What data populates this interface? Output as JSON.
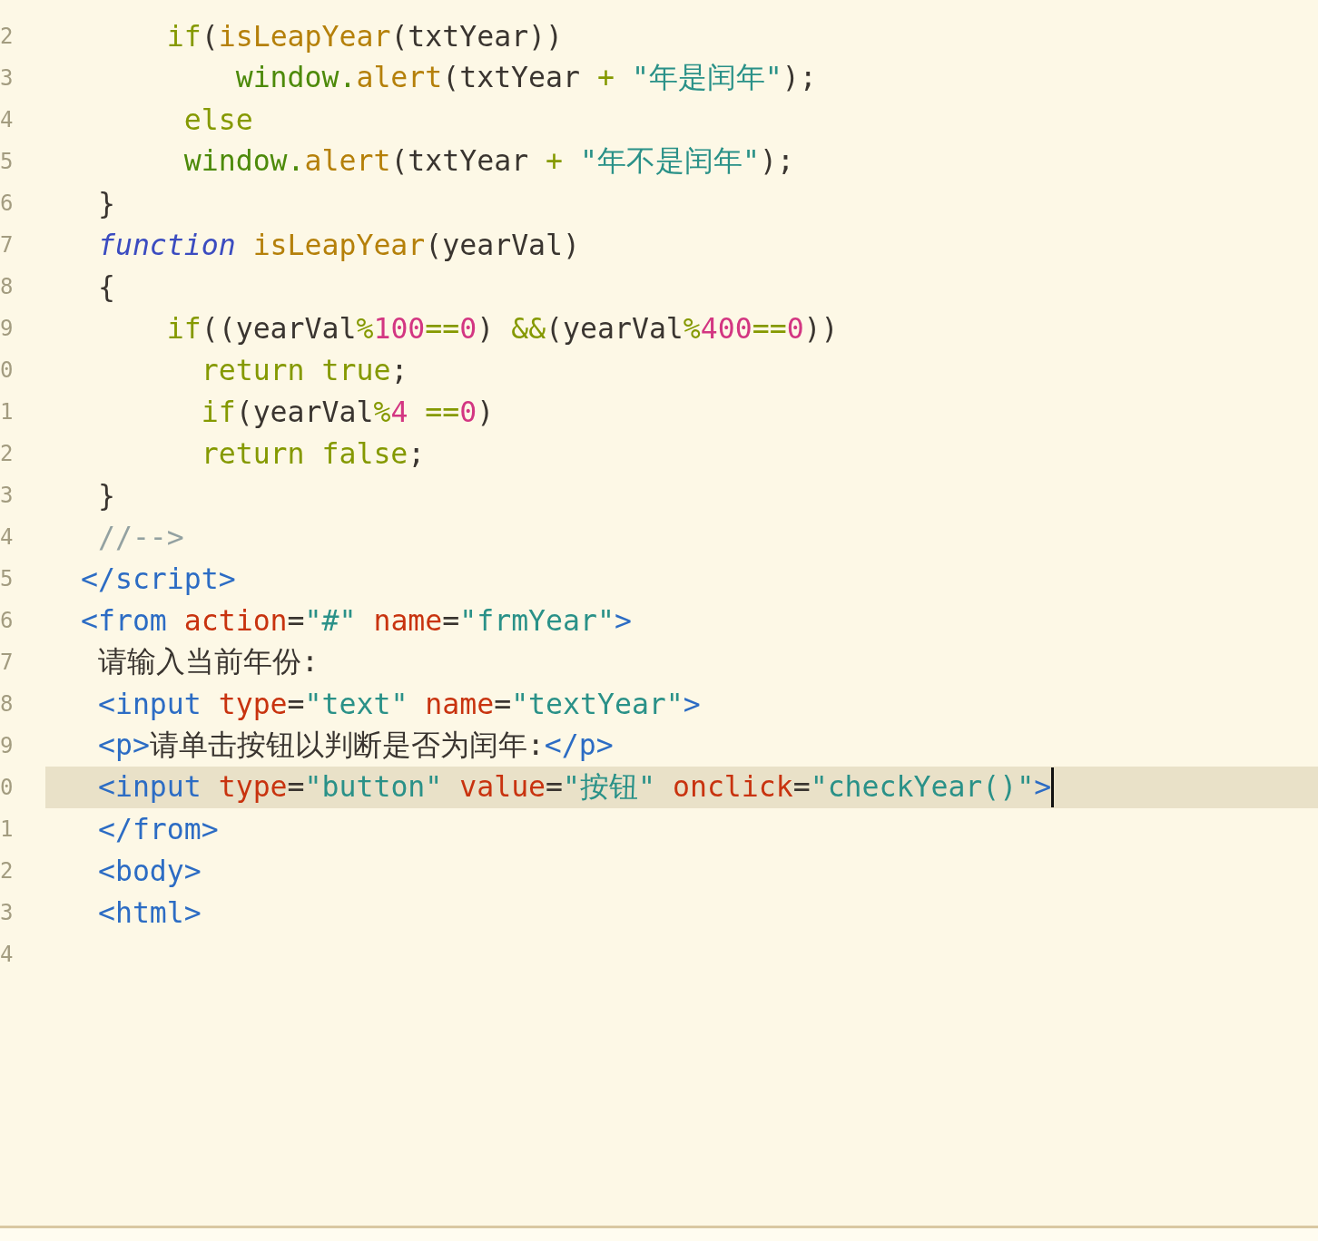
{
  "editor": {
    "lines": [
      {
        "number": "2",
        "current": false,
        "tokens": [
          {
            "kind": "keyword",
            "text": "     if"
          },
          {
            "kind": "plain",
            "text": "("
          },
          {
            "kind": "func",
            "text": "isLeapYear"
          },
          {
            "kind": "plain",
            "text": "(txtYear))"
          }
        ]
      },
      {
        "number": "3",
        "current": false,
        "tokens": [
          {
            "kind": "object",
            "text": "         window."
          },
          {
            "kind": "func",
            "text": "alert"
          },
          {
            "kind": "plain",
            "text": "(txtYear "
          },
          {
            "kind": "operator",
            "text": "+ "
          },
          {
            "kind": "string",
            "text": "\"年是闰年\""
          },
          {
            "kind": "plain",
            "text": ");"
          }
        ]
      },
      {
        "number": "4",
        "current": false,
        "tokens": [
          {
            "kind": "keyword",
            "text": "      else"
          }
        ]
      },
      {
        "number": "5",
        "current": false,
        "tokens": [
          {
            "kind": "object",
            "text": "      window."
          },
          {
            "kind": "func",
            "text": "alert"
          },
          {
            "kind": "plain",
            "text": "(txtYear "
          },
          {
            "kind": "operator",
            "text": "+ "
          },
          {
            "kind": "string",
            "text": "\"年不是闰年\""
          },
          {
            "kind": "plain",
            "text": ");"
          }
        ]
      },
      {
        "number": "6",
        "current": false,
        "tokens": [
          {
            "kind": "plain",
            "text": " }"
          }
        ]
      },
      {
        "number": "7",
        "current": false,
        "tokens": [
          {
            "kind": "storage",
            "text": " function"
          },
          {
            "kind": "func",
            "text": " isLeapYear"
          },
          {
            "kind": "plain",
            "text": "(yearVal)"
          }
        ]
      },
      {
        "number": "8",
        "current": false,
        "tokens": [
          {
            "kind": "plain",
            "text": " {"
          }
        ]
      },
      {
        "number": "9",
        "current": false,
        "tokens": [
          {
            "kind": "keyword",
            "text": "     if"
          },
          {
            "kind": "plain",
            "text": "((yearVal"
          },
          {
            "kind": "operator",
            "text": "%"
          },
          {
            "kind": "number",
            "text": "100"
          },
          {
            "kind": "operator",
            "text": "=="
          },
          {
            "kind": "number",
            "text": "0"
          },
          {
            "kind": "plain",
            "text": ") "
          },
          {
            "kind": "operator",
            "text": "&&"
          },
          {
            "kind": "plain",
            "text": "(yearVal"
          },
          {
            "kind": "operator",
            "text": "%"
          },
          {
            "kind": "number",
            "text": "400"
          },
          {
            "kind": "operator",
            "text": "=="
          },
          {
            "kind": "number",
            "text": "0"
          },
          {
            "kind": "plain",
            "text": "))"
          }
        ]
      },
      {
        "number": "0",
        "current": false,
        "tokens": [
          {
            "kind": "keyword",
            "text": "       return true"
          },
          {
            "kind": "plain",
            "text": ";"
          }
        ]
      },
      {
        "number": "1",
        "current": false,
        "tokens": [
          {
            "kind": "keyword",
            "text": "       if"
          },
          {
            "kind": "plain",
            "text": "(yearVal"
          },
          {
            "kind": "operator",
            "text": "%"
          },
          {
            "kind": "number",
            "text": "4 "
          },
          {
            "kind": "operator",
            "text": "=="
          },
          {
            "kind": "number",
            "text": "0"
          },
          {
            "kind": "plain",
            "text": ")"
          }
        ]
      },
      {
        "number": "2",
        "current": false,
        "tokens": [
          {
            "kind": "keyword",
            "text": "       return false"
          },
          {
            "kind": "plain",
            "text": ";"
          }
        ]
      },
      {
        "number": "3",
        "current": false,
        "tokens": [
          {
            "kind": "plain",
            "text": " }"
          }
        ]
      },
      {
        "number": "4",
        "current": false,
        "tokens": [
          {
            "kind": "comment",
            "text": " //-->"
          }
        ]
      },
      {
        "number": "5",
        "current": false,
        "tokens": [
          {
            "kind": "tag",
            "text": "</script>"
          }
        ]
      },
      {
        "number": "6",
        "current": false,
        "tokens": [
          {
            "kind": "tag",
            "text": "<from"
          },
          {
            "kind": "attr",
            "text": " action"
          },
          {
            "kind": "plain",
            "text": "="
          },
          {
            "kind": "string",
            "text": "\"#\""
          },
          {
            "kind": "attr",
            "text": " name"
          },
          {
            "kind": "plain",
            "text": "="
          },
          {
            "kind": "string",
            "text": "\"frmYear\""
          },
          {
            "kind": "tag",
            "text": ">"
          }
        ]
      },
      {
        "number": "7",
        "current": false,
        "tokens": [
          {
            "kind": "plain",
            "text": " 请输入当前年份:"
          }
        ]
      },
      {
        "number": "8",
        "current": false,
        "tokens": [
          {
            "kind": "tag",
            "text": " <input"
          },
          {
            "kind": "attr",
            "text": " type"
          },
          {
            "kind": "plain",
            "text": "="
          },
          {
            "kind": "string",
            "text": "\"text\""
          },
          {
            "kind": "attr",
            "text": " name"
          },
          {
            "kind": "plain",
            "text": "="
          },
          {
            "kind": "string",
            "text": "\"textYear\""
          },
          {
            "kind": "tag",
            "text": ">"
          }
        ]
      },
      {
        "number": "9",
        "current": false,
        "tokens": [
          {
            "kind": "tag",
            "text": " <p>"
          },
          {
            "kind": "plain",
            "text": "请单击按钮以判断是否为闰年:"
          },
          {
            "kind": "tag",
            "text": "</p>"
          }
        ]
      },
      {
        "number": "0",
        "current": true,
        "tokens": [
          {
            "kind": "tag",
            "text": " <input"
          },
          {
            "kind": "attr",
            "text": " type"
          },
          {
            "kind": "plain",
            "text": "="
          },
          {
            "kind": "string",
            "text": "\"button\""
          },
          {
            "kind": "attr",
            "text": " value"
          },
          {
            "kind": "plain",
            "text": "="
          },
          {
            "kind": "string",
            "text": "\"按钮\""
          },
          {
            "kind": "attr",
            "text": " onclick"
          },
          {
            "kind": "plain",
            "text": "="
          },
          {
            "kind": "string",
            "text": "\"checkYear()\""
          },
          {
            "kind": "tag",
            "text": ">"
          }
        ]
      },
      {
        "number": "1",
        "current": false,
        "tokens": [
          {
            "kind": "tag",
            "text": " </from>"
          }
        ]
      },
      {
        "number": "2",
        "current": false,
        "tokens": [
          {
            "kind": "tag",
            "text": " <body>"
          }
        ]
      },
      {
        "number": "3",
        "current": false,
        "tokens": [
          {
            "kind": "tag",
            "text": " <html>"
          }
        ]
      },
      {
        "number": "4",
        "current": false
      }
    ]
  }
}
